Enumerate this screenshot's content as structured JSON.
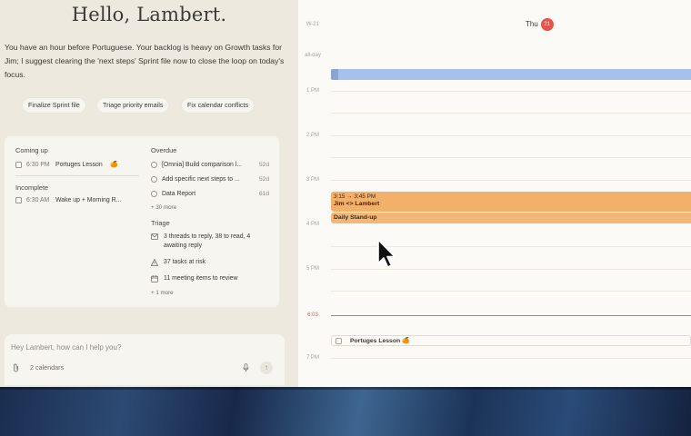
{
  "greeting": "Hello, Lambert.",
  "intro": "You have an hour before Portuguese. Your backlog is heavy on Growth tasks for Jim; I suggest clearing the 'next steps' Sprint file now to close the loop on today's focus.",
  "chips": [
    "Finalize Sprint file",
    "Triage priority emails",
    "Fix calendar conflicts"
  ],
  "coming_up": {
    "heading": "Coming up",
    "items": [
      {
        "time": "6:30 PM",
        "title": "Portuges Lesson",
        "emoji": "🍊"
      }
    ]
  },
  "incomplete": {
    "heading": "Incomplete",
    "items": [
      {
        "time": "6:30 AM",
        "title": "Wake up + Morning R..."
      }
    ]
  },
  "overdue": {
    "heading": "Overdue",
    "items": [
      {
        "title": "[Omnia] Build comparison l...",
        "age": "52d"
      },
      {
        "title": "Add specific next steps to ...",
        "age": "52d"
      },
      {
        "title": "Data Report",
        "age": "61d"
      }
    ],
    "more": "+ 30 more"
  },
  "triage": {
    "heading": "Triage",
    "items": [
      {
        "icon": "mail-icon",
        "line1": "3 threads to reply, 38 to read, 4",
        "line2": "awaiting reply"
      },
      {
        "icon": "warning-icon",
        "line1": "37 tasks at risk",
        "line2": ""
      },
      {
        "icon": "calendar-icon",
        "line1": "11 meeting items to review",
        "line2": ""
      }
    ],
    "more": "+ 1 more"
  },
  "composer": {
    "placeholder": "Hey Lambert, how can I help you?",
    "calendars": "2 calendars"
  },
  "calendar": {
    "week": "W-21",
    "day": "Thu",
    "date": "21",
    "allday_label": "all-day",
    "hours": [
      "1 PM",
      "2 PM",
      "3 PM",
      "4 PM",
      "5 PM",
      "7 PM"
    ],
    "now": "6:03",
    "events": [
      {
        "time": "3:15 → 3:45 PM",
        "title": "Jim <> Lambert"
      },
      {
        "title": "Daily Stand-up"
      }
    ],
    "allday_event": "Portuges Lesson",
    "allday_event_emoji": "🍊",
    "allday_bar_color": "#a6c2ea",
    "event_color": "#f2b06b",
    "now_color": "#e06a66"
  }
}
